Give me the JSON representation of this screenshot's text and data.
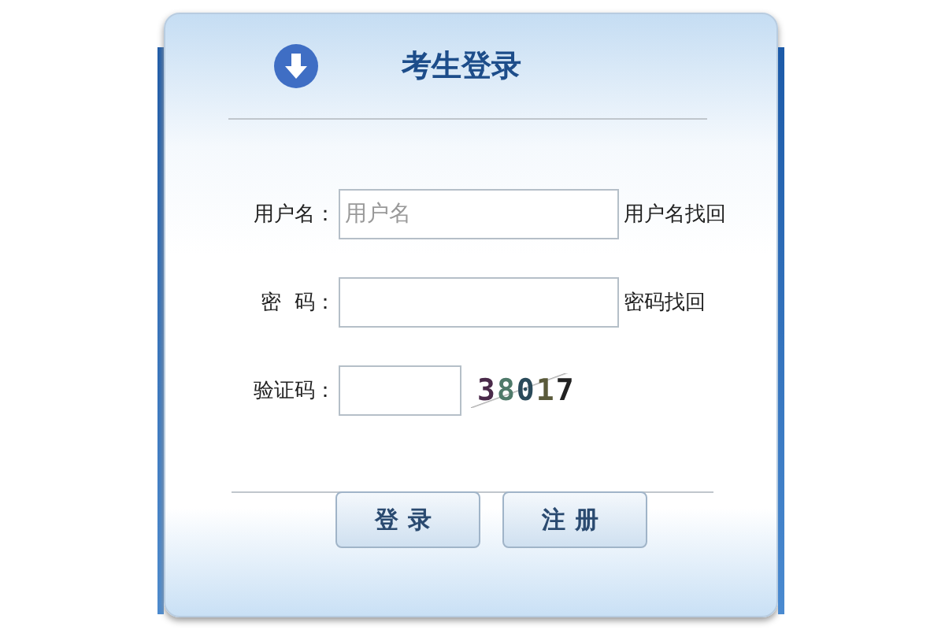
{
  "title": "考生登录",
  "fields": [
    {
      "label": "用户名：",
      "placeholder": "用户名",
      "link": "用户名找回",
      "kind": "wide"
    },
    {
      "label": "密  码：",
      "link": "密码找回",
      "kind": "wide"
    },
    {
      "label": "验证码：",
      "kind": "captcha",
      "captcha": "38017"
    }
  ],
  "buttons": [
    "登录",
    "注册"
  ]
}
